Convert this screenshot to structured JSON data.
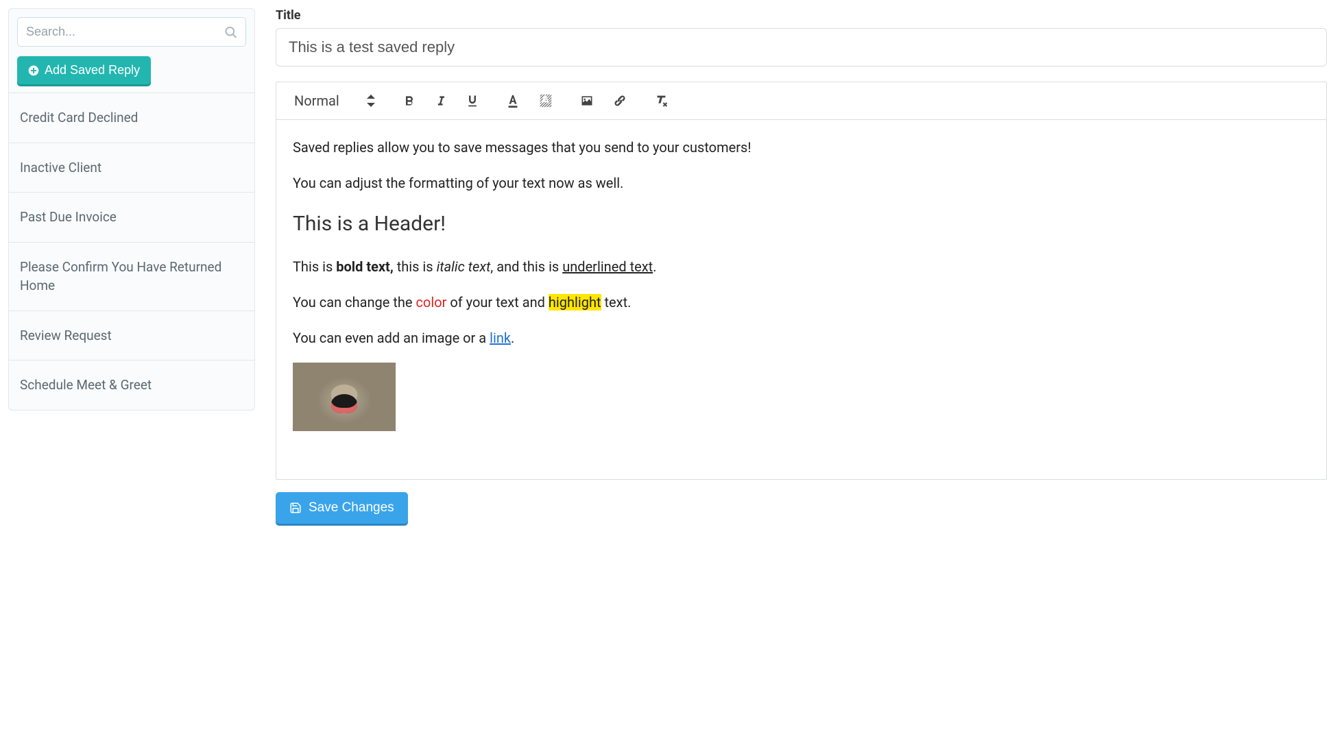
{
  "sidebar": {
    "search_placeholder": "Search...",
    "add_button_label": "Add Saved Reply",
    "items": [
      {
        "label": "Credit Card Declined"
      },
      {
        "label": "Inactive Client"
      },
      {
        "label": "Past Due Invoice"
      },
      {
        "label": "Please Confirm You Have Returned Home"
      },
      {
        "label": "Review Request"
      },
      {
        "label": "Schedule Meet & Greet"
      }
    ]
  },
  "main": {
    "title_label": "Title",
    "title_value": "This is a test saved reply",
    "save_label": "Save Changes"
  },
  "toolbar": {
    "format_label": "Normal"
  },
  "content": {
    "p1": "Saved replies allow you to save messages that you send to your customers!",
    "p2": "You can adjust the formatting of your text now as well.",
    "h1": "This is a Header!",
    "p3_a": "This is ",
    "p3_bold": "bold text,",
    "p3_b": " this is ",
    "p3_italic": "italic text",
    "p3_c": ", and this is ",
    "p3_under": "underlined text",
    "p3_d": ".",
    "p4_a": "You can change the ",
    "p4_color": "color",
    "p4_b": " of your text and ",
    "p4_hl": "highlight",
    "p4_c": " text.",
    "p5_a": "You can even add an image or a ",
    "p5_link": "link",
    "p5_b": "."
  }
}
